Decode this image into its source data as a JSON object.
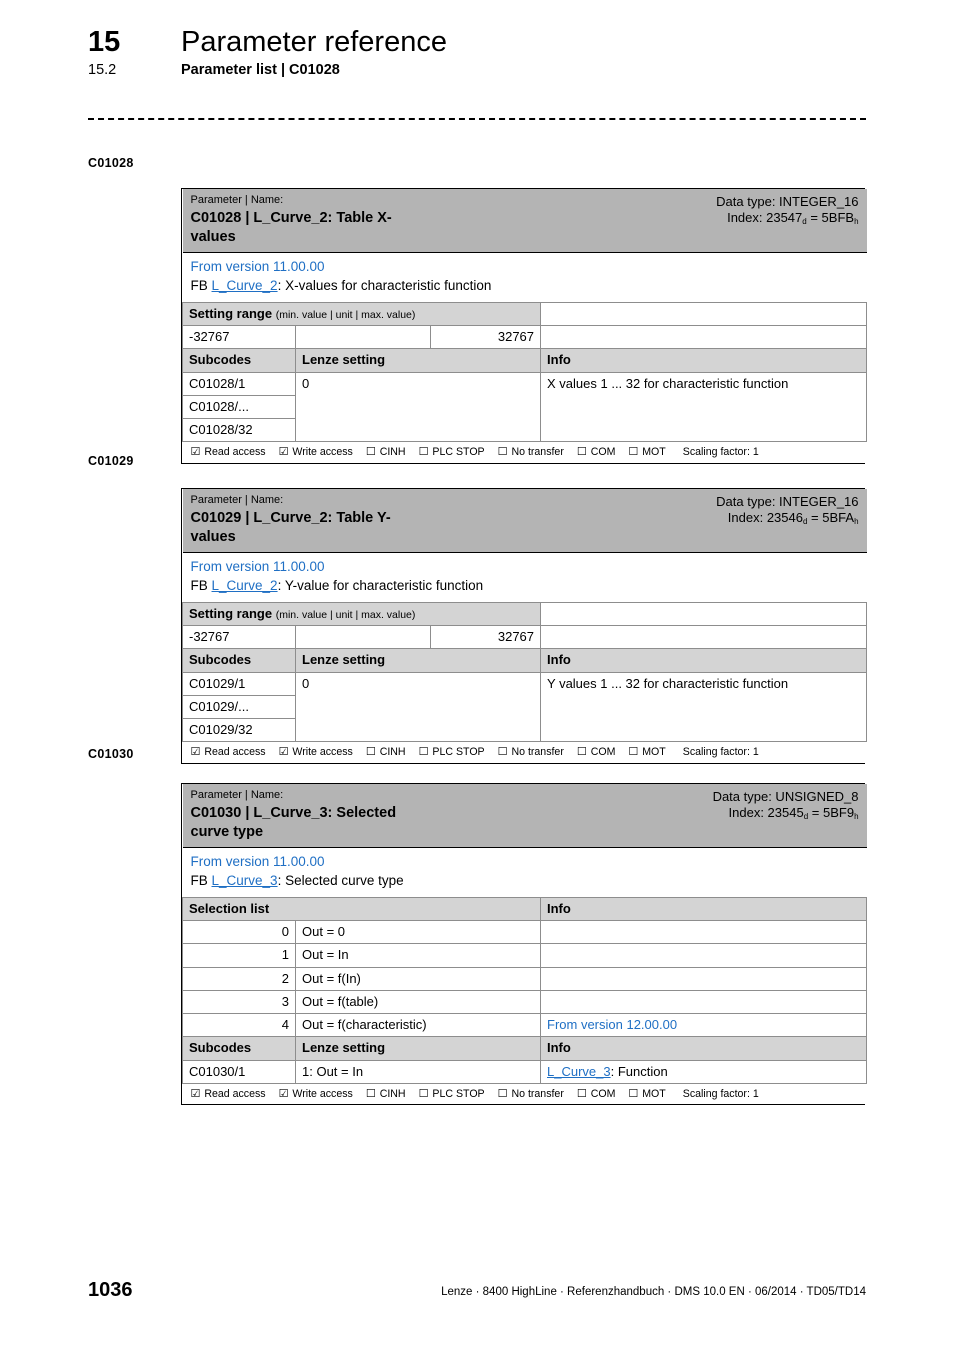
{
  "header": {
    "chapter_number": "15",
    "chapter_title": "Parameter reference",
    "section_number": "15.2",
    "section_title": "Parameter list | C01028"
  },
  "colors": {
    "link_blue": "#1f6fc4",
    "title_band_gray": "#b4b4b4",
    "subheader_gray": "#d4d4d4",
    "border_black": "#000000",
    "border_gray": "#8d8d8d"
  },
  "margin_labels": [
    "C01028",
    "C01029",
    "C01030"
  ],
  "access_row": {
    "items": [
      {
        "label": "Read access",
        "checked": true
      },
      {
        "label": "Write access",
        "checked": true
      },
      {
        "label": "CINH",
        "checked": false
      },
      {
        "label": "PLC STOP",
        "checked": false
      },
      {
        "label": "No transfer",
        "checked": false
      },
      {
        "label": "COM",
        "checked": false
      },
      {
        "label": "MOT",
        "checked": false
      }
    ],
    "checked_glyph": "☑",
    "unchecked_glyph": "☐",
    "scaling_factor": "Scaling factor: 1"
  },
  "tables": [
    {
      "id": "c01028",
      "title_caption": "Parameter | Name:",
      "title_main": "C01028 | L_Curve_2: Table X-values",
      "data_type": "Data type: INTEGER_16",
      "index_prefix": "Index: ",
      "index_dec": "23547",
      "index_dec_sub": "d",
      "index_eq": " = ",
      "index_hex": "5BFB",
      "index_hex_sub": "h",
      "from_version": "From version 11.00.00",
      "fb_prefix": "FB ",
      "fb_link": "L_Curve_2",
      "fb_suffix": ": X-values for characteristic function",
      "setting_range": {
        "header": "Setting range",
        "header_note": "(min. value | unit | max. value)",
        "min": "-32767",
        "unit": "",
        "max": "32767"
      },
      "subcodes_header": [
        "Subcodes",
        "Lenze setting",
        "Info"
      ],
      "subcode_rows": [
        {
          "subcode": "C01028/1",
          "lenze_setting": "0",
          "info": "X values 1 ... 32 for characteristic function"
        },
        {
          "subcode": "C01028/...",
          "lenze_setting": "",
          "info": ""
        },
        {
          "subcode": "C01028/32",
          "lenze_setting": "",
          "info": ""
        }
      ]
    },
    {
      "id": "c01029",
      "title_caption": "Parameter | Name:",
      "title_main": "C01029 | L_Curve_2: Table Y-values",
      "data_type": "Data type: INTEGER_16",
      "index_prefix": "Index: ",
      "index_dec": "23546",
      "index_dec_sub": "d",
      "index_eq": " = ",
      "index_hex": "5BFA",
      "index_hex_sub": "h",
      "from_version": "From version 11.00.00",
      "fb_prefix": "FB ",
      "fb_link": "L_Curve_2",
      "fb_suffix": ": Y-value for characteristic function",
      "setting_range": {
        "header": "Setting range",
        "header_note": "(min. value | unit | max. value)",
        "min": "-32767",
        "unit": "",
        "max": "32767"
      },
      "subcodes_header": [
        "Subcodes",
        "Lenze setting",
        "Info"
      ],
      "subcode_rows": [
        {
          "subcode": "C01029/1",
          "lenze_setting": "0",
          "info": "Y values 1 ... 32 for characteristic function"
        },
        {
          "subcode": "C01029/...",
          "lenze_setting": "",
          "info": ""
        },
        {
          "subcode": "C01029/32",
          "lenze_setting": "",
          "info": ""
        }
      ]
    },
    {
      "id": "c01030",
      "title_caption": "Parameter | Name:",
      "title_main": "C01030 | L_Curve_3: Selected curve type",
      "data_type": "Data type: UNSIGNED_8",
      "index_prefix": "Index: ",
      "index_dec": "23545",
      "index_dec_sub": "d",
      "index_eq": " = ",
      "index_hex": "5BF9",
      "index_hex_sub": "h",
      "from_version": "From version 11.00.00",
      "fb_prefix": "FB ",
      "fb_link": "L_Curve_3",
      "fb_suffix": ": Selected curve type",
      "selection_list_header": [
        "Selection list",
        "Info"
      ],
      "selection_rows": [
        {
          "value": "0",
          "label": "Out = 0",
          "info": "",
          "info_is_link_blue": false
        },
        {
          "value": "1",
          "label": "Out = In",
          "info": "",
          "info_is_link_blue": false
        },
        {
          "value": "2",
          "label": "Out = f(In)",
          "info": "",
          "info_is_link_blue": false
        },
        {
          "value": "3",
          "label": "Out = f(table)",
          "info": "",
          "info_is_link_blue": false
        },
        {
          "value": "4",
          "label": "Out = f(characteristic)",
          "info": "From version 12.00.00",
          "info_is_link_blue": true
        }
      ],
      "subcodes_header": [
        "Subcodes",
        "Lenze setting",
        "Info"
      ],
      "subcode_rows_linked": [
        {
          "subcode": "C01030/1",
          "lenze_setting": "1: Out = In",
          "info_link": "L_Curve_3",
          "info_suffix": ": Function"
        }
      ]
    }
  ],
  "footer": {
    "page_number": "1036",
    "document_line": "Lenze · 8400 HighLine · Referenzhandbuch · DMS 10.0 EN · 06/2014 · TD05/TD14"
  }
}
